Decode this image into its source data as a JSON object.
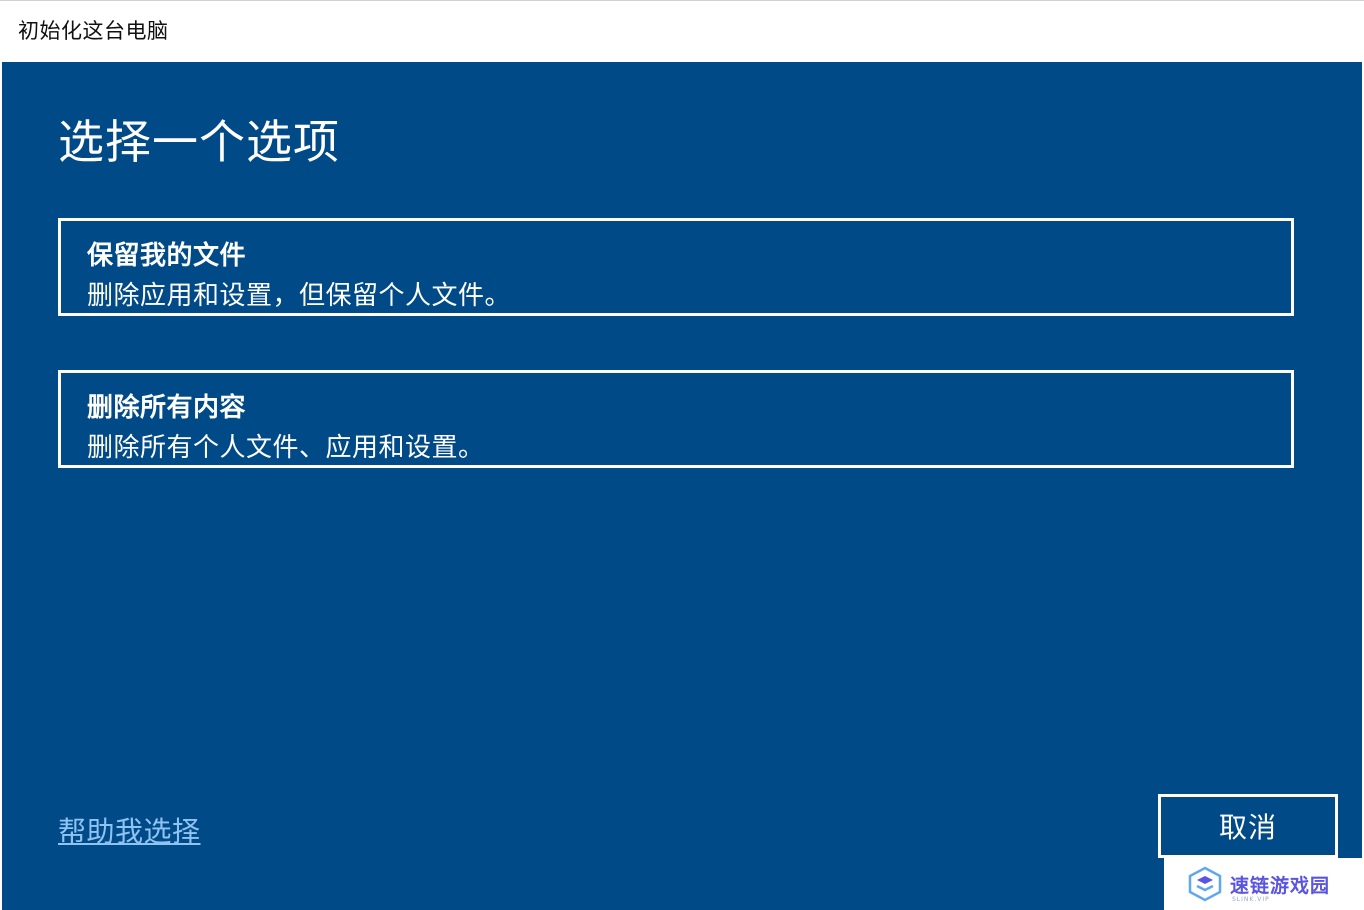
{
  "window": {
    "title": "初始化这台电脑"
  },
  "dialog": {
    "heading": "选择一个选项",
    "options": [
      {
        "title": "保留我的文件",
        "description": "删除应用和设置，但保留个人文件。"
      },
      {
        "title": "删除所有内容",
        "description": "删除所有个人文件、应用和设置。"
      }
    ],
    "help_link": "帮助我选择",
    "cancel_label": "取消"
  },
  "watermark": {
    "text": "速链游戏园",
    "subtext": "SLINK.VIP"
  },
  "colors": {
    "background": "#004a88",
    "text": "#ffffff",
    "link": "#8fc3f2",
    "watermark": "#5a55e0"
  }
}
